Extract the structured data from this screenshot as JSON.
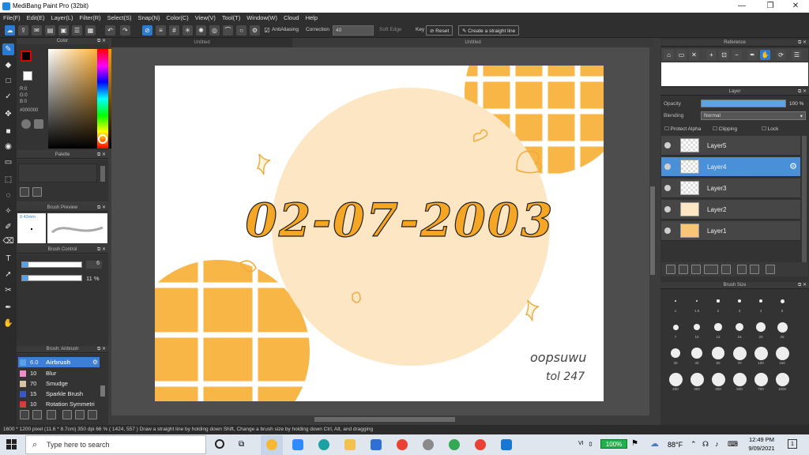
{
  "window": {
    "title": "MediBang Paint Pro (32bit)",
    "minimize": "—",
    "maximize": "❐",
    "close": "✕"
  },
  "menu": [
    "File(F)",
    "Edit(E)",
    "Layer(L)",
    "Filter(R)",
    "Select(S)",
    "Snap(N)",
    "Color(C)",
    "View(V)",
    "Tool(T)",
    "Window(W)",
    "Cloud",
    "Help"
  ],
  "toolbar": {
    "antialiasing_label": "AntiAliasing",
    "correction_label": "Correction",
    "correction_value": "40",
    "soft_edge_label": "Soft Edge",
    "key_label": "Key",
    "reset_label": "Reset",
    "straight_line_label": "Create a straight line"
  },
  "doc_tabs": [
    "Untitled",
    "Untitled"
  ],
  "color_panel": {
    "title": "Color",
    "r": "R:0",
    "g": "G:0",
    "b": "B:0",
    "hex": "#000000",
    "accent": "#ff9d00"
  },
  "palette_panel": {
    "title": "Palette"
  },
  "brush_preview": {
    "title": "Brush Preview",
    "size_label": "0.43mm"
  },
  "brush_control": {
    "title": "Brush Control",
    "size": "6",
    "opacity": "11 %",
    "opacity_fraction": 0.11
  },
  "brush_list": {
    "title": "Brush: Airbrush",
    "items": [
      {
        "size": "6.0",
        "name": "Airbrush",
        "color": "#5aa0e6"
      },
      {
        "size": "10",
        "name": "Blur",
        "color": "#f08cc8"
      },
      {
        "size": "70",
        "name": "Smudge",
        "color": "#d9c4a0"
      },
      {
        "size": "15",
        "name": "Sparkle Brush",
        "color": "#3a56c8"
      },
      {
        "size": "10",
        "name": "Rotation Symmetri",
        "color": "#d83b3b"
      }
    ]
  },
  "artwork": {
    "text": "02-07-2003",
    "signature_line1": "oopsuwu",
    "signature_line2": "tol 247",
    "accent": "#f7b645",
    "light": "#fde6c3"
  },
  "reference_panel": {
    "title": "Reference"
  },
  "layer_panel": {
    "title": "Layer",
    "opacity_label": "Opacity",
    "opacity_value": "100 %",
    "blending_label": "Blending",
    "blending_value": "Normal",
    "protect_alpha_label": "Protect Alpha",
    "clipping_label": "Clipping",
    "lock_label": "Lock",
    "layers": [
      {
        "name": "Layer5",
        "selected": false
      },
      {
        "name": "Layer4",
        "selected": true
      },
      {
        "name": "Layer3",
        "selected": false
      },
      {
        "name": "Layer2",
        "selected": false
      },
      {
        "name": "Layer1",
        "selected": false
      }
    ]
  },
  "brush_size_panel": {
    "title": "Brush Size",
    "sizes": [
      "1",
      "1.5",
      "2",
      "3",
      "4",
      "5",
      "7",
      "10",
      "12",
      "15",
      "20",
      "25",
      "30",
      "40",
      "50",
      "70",
      "100",
      "150",
      "200",
      "300",
      "400",
      "500",
      "700",
      "1000"
    ]
  },
  "status": {
    "text": "1600 * 1200 pixel   (11.6 * 8.7cm)  350 dpi   66 %   ( 1424, 557 )   Draw a straight line by holding down Shift, Change a brush size by holding down Ctrl, Alt, and dragging"
  },
  "taskbar": {
    "search_placeholder": "Type here to search",
    "battery": "100%",
    "weather": "88°F",
    "time": "12:49 PM",
    "date": "9/09/2021",
    "notifications": "1"
  }
}
